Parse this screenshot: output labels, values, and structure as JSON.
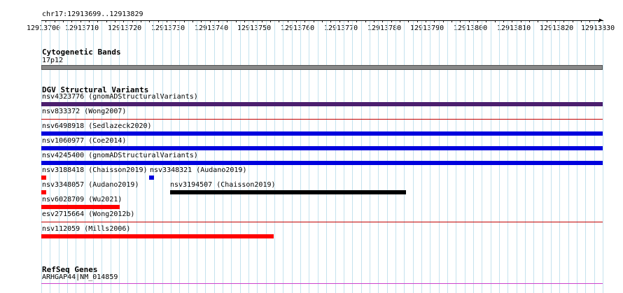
{
  "ruler": {
    "region": "chr17:12913699..12913829",
    "ticks": [
      "12913700",
      "12913710",
      "12913720",
      "12913730",
      "12913740",
      "12913750",
      "12913760",
      "12913770",
      "12913780",
      "12913790",
      "12913800",
      "12913810",
      "12913820",
      "12913830"
    ]
  },
  "tracks": {
    "cytoband": {
      "title": "Cytogenetic Bands",
      "band_label": "17p12",
      "color": "#888888"
    },
    "dgv": {
      "title": "DGV Structural Variants",
      "items": [
        {
          "label": "nsv4323776 (gnomADStructuralVariants)",
          "color": "#4b1f6f",
          "start": 12913700,
          "end": 12913830,
          "style": "thick"
        },
        {
          "label": "nsv833372 (Wong2007)",
          "color": "#c00000",
          "start": 12913700,
          "end": 12913830,
          "style": "thin"
        },
        {
          "label": "nsv6498918 (Sedlazeck2020)",
          "color": "#0000dd",
          "start": 12913700,
          "end": 12913830,
          "style": "thick"
        },
        {
          "label": "nsv1060977 (Coe2014)",
          "color": "#0000dd",
          "start": 12913700,
          "end": 12913830,
          "style": "thick"
        },
        {
          "label": "nsv4245400 (gnomADStructuralVariants)",
          "color": "#0000dd",
          "start": 12913700,
          "end": 12913830,
          "style": "thick"
        },
        {
          "label": "nsv3188418 (Chaisson2019)",
          "color": "#ff0000",
          "start": 12913700,
          "end": 12913701,
          "style": "block"
        },
        {
          "label": "nsv3348321 (Audano2019)",
          "color": "#0000dd",
          "start": 12913725,
          "end": 12913726,
          "style": "block"
        },
        {
          "label": "nsv3348057 (Audano2019)",
          "color": "#ff0000",
          "start": 12913700,
          "end": 12913701,
          "style": "block"
        },
        {
          "label": "nsv3194507 (Chaisson2019)",
          "color": "#000000",
          "start": 12913730,
          "end": 12913785,
          "style": "thickblack"
        },
        {
          "label": "nsv6028709 (Wu2021)",
          "color": "#ff0000",
          "start": 12913700,
          "end": 12913718,
          "style": "thick"
        },
        {
          "label": "esv2715664 (Wong2012b)",
          "color": "#c00000",
          "start": 12913700,
          "end": 12913830,
          "style": "thin"
        },
        {
          "label": "nsv112059 (Mills2006)",
          "color": "#ff0000",
          "start": 12913700,
          "end": 12913754,
          "style": "thick"
        }
      ]
    },
    "refseq": {
      "title": "RefSeq Genes",
      "gene_label": "ARHGAP44|NM_014859",
      "color": "#cc44cc"
    }
  }
}
